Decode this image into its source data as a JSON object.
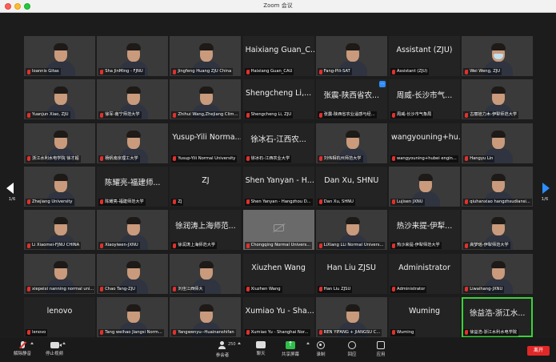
{
  "window": {
    "title": "Zoom 会议"
  },
  "pager": {
    "left_label": "1/6",
    "right_label": "1/6"
  },
  "tiles": [
    {
      "label": "Ioannis Gitas",
      "big": "",
      "kind": "video",
      "style": "v-a"
    },
    {
      "label": "Sha JinMing - FJNU",
      "big": "",
      "kind": "video",
      "style": "v-b"
    },
    {
      "label": "Jingfeng Huang ZJU China",
      "big": "",
      "kind": "video",
      "style": "v-c"
    },
    {
      "label": "Haixiang Guan_CAU",
      "big": "Haixiang Guan_C...",
      "kind": "name"
    },
    {
      "label": "Fang-Pili-SAT",
      "big": "",
      "kind": "video",
      "style": "v-d"
    },
    {
      "label": "Assistant (ZJU)",
      "big": "Assistant (ZJU)",
      "kind": "name"
    },
    {
      "label": "Wei Weng, ZJU",
      "big": "",
      "kind": "video",
      "style": "v-e"
    },
    {
      "label": "Yuanjun Xiao, ZJU",
      "big": "",
      "kind": "video",
      "style": "v-e"
    },
    {
      "label": "徐军-南宁师范大学",
      "big": "",
      "kind": "video",
      "style": "v-f"
    },
    {
      "label": "Zhihui Wang,Zhejiang Clim...",
      "big": "",
      "kind": "video",
      "style": "v-c"
    },
    {
      "label": "Shengcheng Li, ZJU",
      "big": "Shengcheng Li,...",
      "kind": "name"
    },
    {
      "label": "张震-陕西省农业遥感与经...",
      "big": "张震-陕西省农...",
      "kind": "name",
      "badge": true
    },
    {
      "label": "周威-长沙市气象局",
      "big": "周威-长沙市气...",
      "kind": "name"
    },
    {
      "label": "古丽娃力木-伊犁师范大学",
      "big": "",
      "kind": "video",
      "style": "v-j"
    },
    {
      "label": "浙江水利水电学院 徐才超",
      "big": "",
      "kind": "video",
      "style": "v-e"
    },
    {
      "label": "杨帆南京理工大学",
      "big": "",
      "kind": "video",
      "style": "v-h"
    },
    {
      "label": "Yusup-Yili Normal University",
      "big": "Yusup-Yili Norma...",
      "kind": "name"
    },
    {
      "label": "徐冰石-江西农业大学",
      "big": "徐冰石-江西农...",
      "kind": "name"
    },
    {
      "label": "刘伟相杭州师范大学",
      "big": "",
      "kind": "video",
      "style": "v-g"
    },
    {
      "label": "wangyouning+hubei engin...",
      "big": "wangyouning+hu...",
      "kind": "name"
    },
    {
      "label": "Hangyu Lin",
      "big": "",
      "kind": "video",
      "style": "v-e"
    },
    {
      "label": "Zhejiang University",
      "big": "",
      "kind": "video",
      "style": "v-i"
    },
    {
      "label": "陈耀亮-福建师范大学",
      "big": "陈耀亮-福建师...",
      "kind": "name"
    },
    {
      "label": "ZJ",
      "big": "ZJ",
      "kind": "name"
    },
    {
      "label": "Shen Yanyan - Hangzhou D...",
      "big": "Shen Yanyan - H...",
      "kind": "name"
    },
    {
      "label": "Dan Xu, SHNU",
      "big": "Dan Xu, SHNU",
      "kind": "name"
    },
    {
      "label": "Lujisen JXNU",
      "big": "",
      "kind": "video",
      "style": "v-f"
    },
    {
      "label": "qiuhanxiao hangzhsudiansi...",
      "big": "",
      "kind": "video",
      "style": "v-g"
    },
    {
      "label": "Li Xiaomei-FJNU CHINA",
      "big": "",
      "kind": "video",
      "style": "v-e"
    },
    {
      "label": "Xiaoyiwen-JXNU",
      "big": "",
      "kind": "video",
      "style": "v-c"
    },
    {
      "label": "徐润涛上海师范大学",
      "big": "徐润涛上海师范...",
      "kind": "name"
    },
    {
      "label": "Chongqing Normal Univers...",
      "big": "",
      "kind": "camoff"
    },
    {
      "label": "LiXiang LLi Normal Univers...",
      "big": "",
      "kind": "video",
      "style": "v-e"
    },
    {
      "label": "热沙来提-伊犁师范大学",
      "big": "热沙来提-伊犁...",
      "kind": "name"
    },
    {
      "label": "高梦瑶-伊犁师范大学",
      "big": "",
      "kind": "video",
      "style": "v-h"
    },
    {
      "label": "xiepeixi nanning normal uni...",
      "big": "",
      "kind": "video",
      "style": "v-f"
    },
    {
      "label": "Chao Tang-ZJU",
      "big": "",
      "kind": "video",
      "style": "v-i"
    },
    {
      "label": "刘佳江西师大",
      "big": "",
      "kind": "video",
      "style": "v-b"
    },
    {
      "label": "Xiuzhen Wang",
      "big": "Xiuzhen Wang",
      "kind": "name"
    },
    {
      "label": "Han Liu ZJSU",
      "big": "Han Liu ZJSU",
      "kind": "name"
    },
    {
      "label": "Administrator",
      "big": "Administrator",
      "kind": "name"
    },
    {
      "label": "Liwaihang-JXNU",
      "big": "",
      "kind": "video",
      "style": "v-j"
    },
    {
      "label": "lenovo",
      "big": "lenovo",
      "kind": "name"
    },
    {
      "label": "Tang weihao Jiangsi Norm...",
      "big": "",
      "kind": "video",
      "style": "v-c"
    },
    {
      "label": "Yangwenyu--Huainanshifan",
      "big": "",
      "kind": "video",
      "style": "v-h"
    },
    {
      "label": "Xumiao Yu - Shanghai Nor...",
      "big": "Xumiao Yu - Sha...",
      "kind": "name"
    },
    {
      "label": "REN YIFANG + JIANGSU C...",
      "big": "",
      "kind": "video",
      "style": "v-e"
    },
    {
      "label": "Wuming",
      "big": "Wuming",
      "kind": "name"
    },
    {
      "label": "徐益浩-浙江水利水电学院",
      "big": "徐益浩-浙江水...",
      "kind": "name",
      "active": true
    }
  ],
  "toolbar": {
    "mute_label": "解除静音",
    "video_label": "停止视频",
    "participants_label": "参会者",
    "participants_count": "250",
    "chat_label": "聊天",
    "share_label": "共享屏幕",
    "record_label": "录制",
    "reactions_label": "回应",
    "apps_label": "应用",
    "leave_label": "离开"
  },
  "colors": {
    "accent": "#2d8cff",
    "leave": "#e02828",
    "share": "#2fbf4b",
    "active_speaker": "#3ad13a"
  }
}
